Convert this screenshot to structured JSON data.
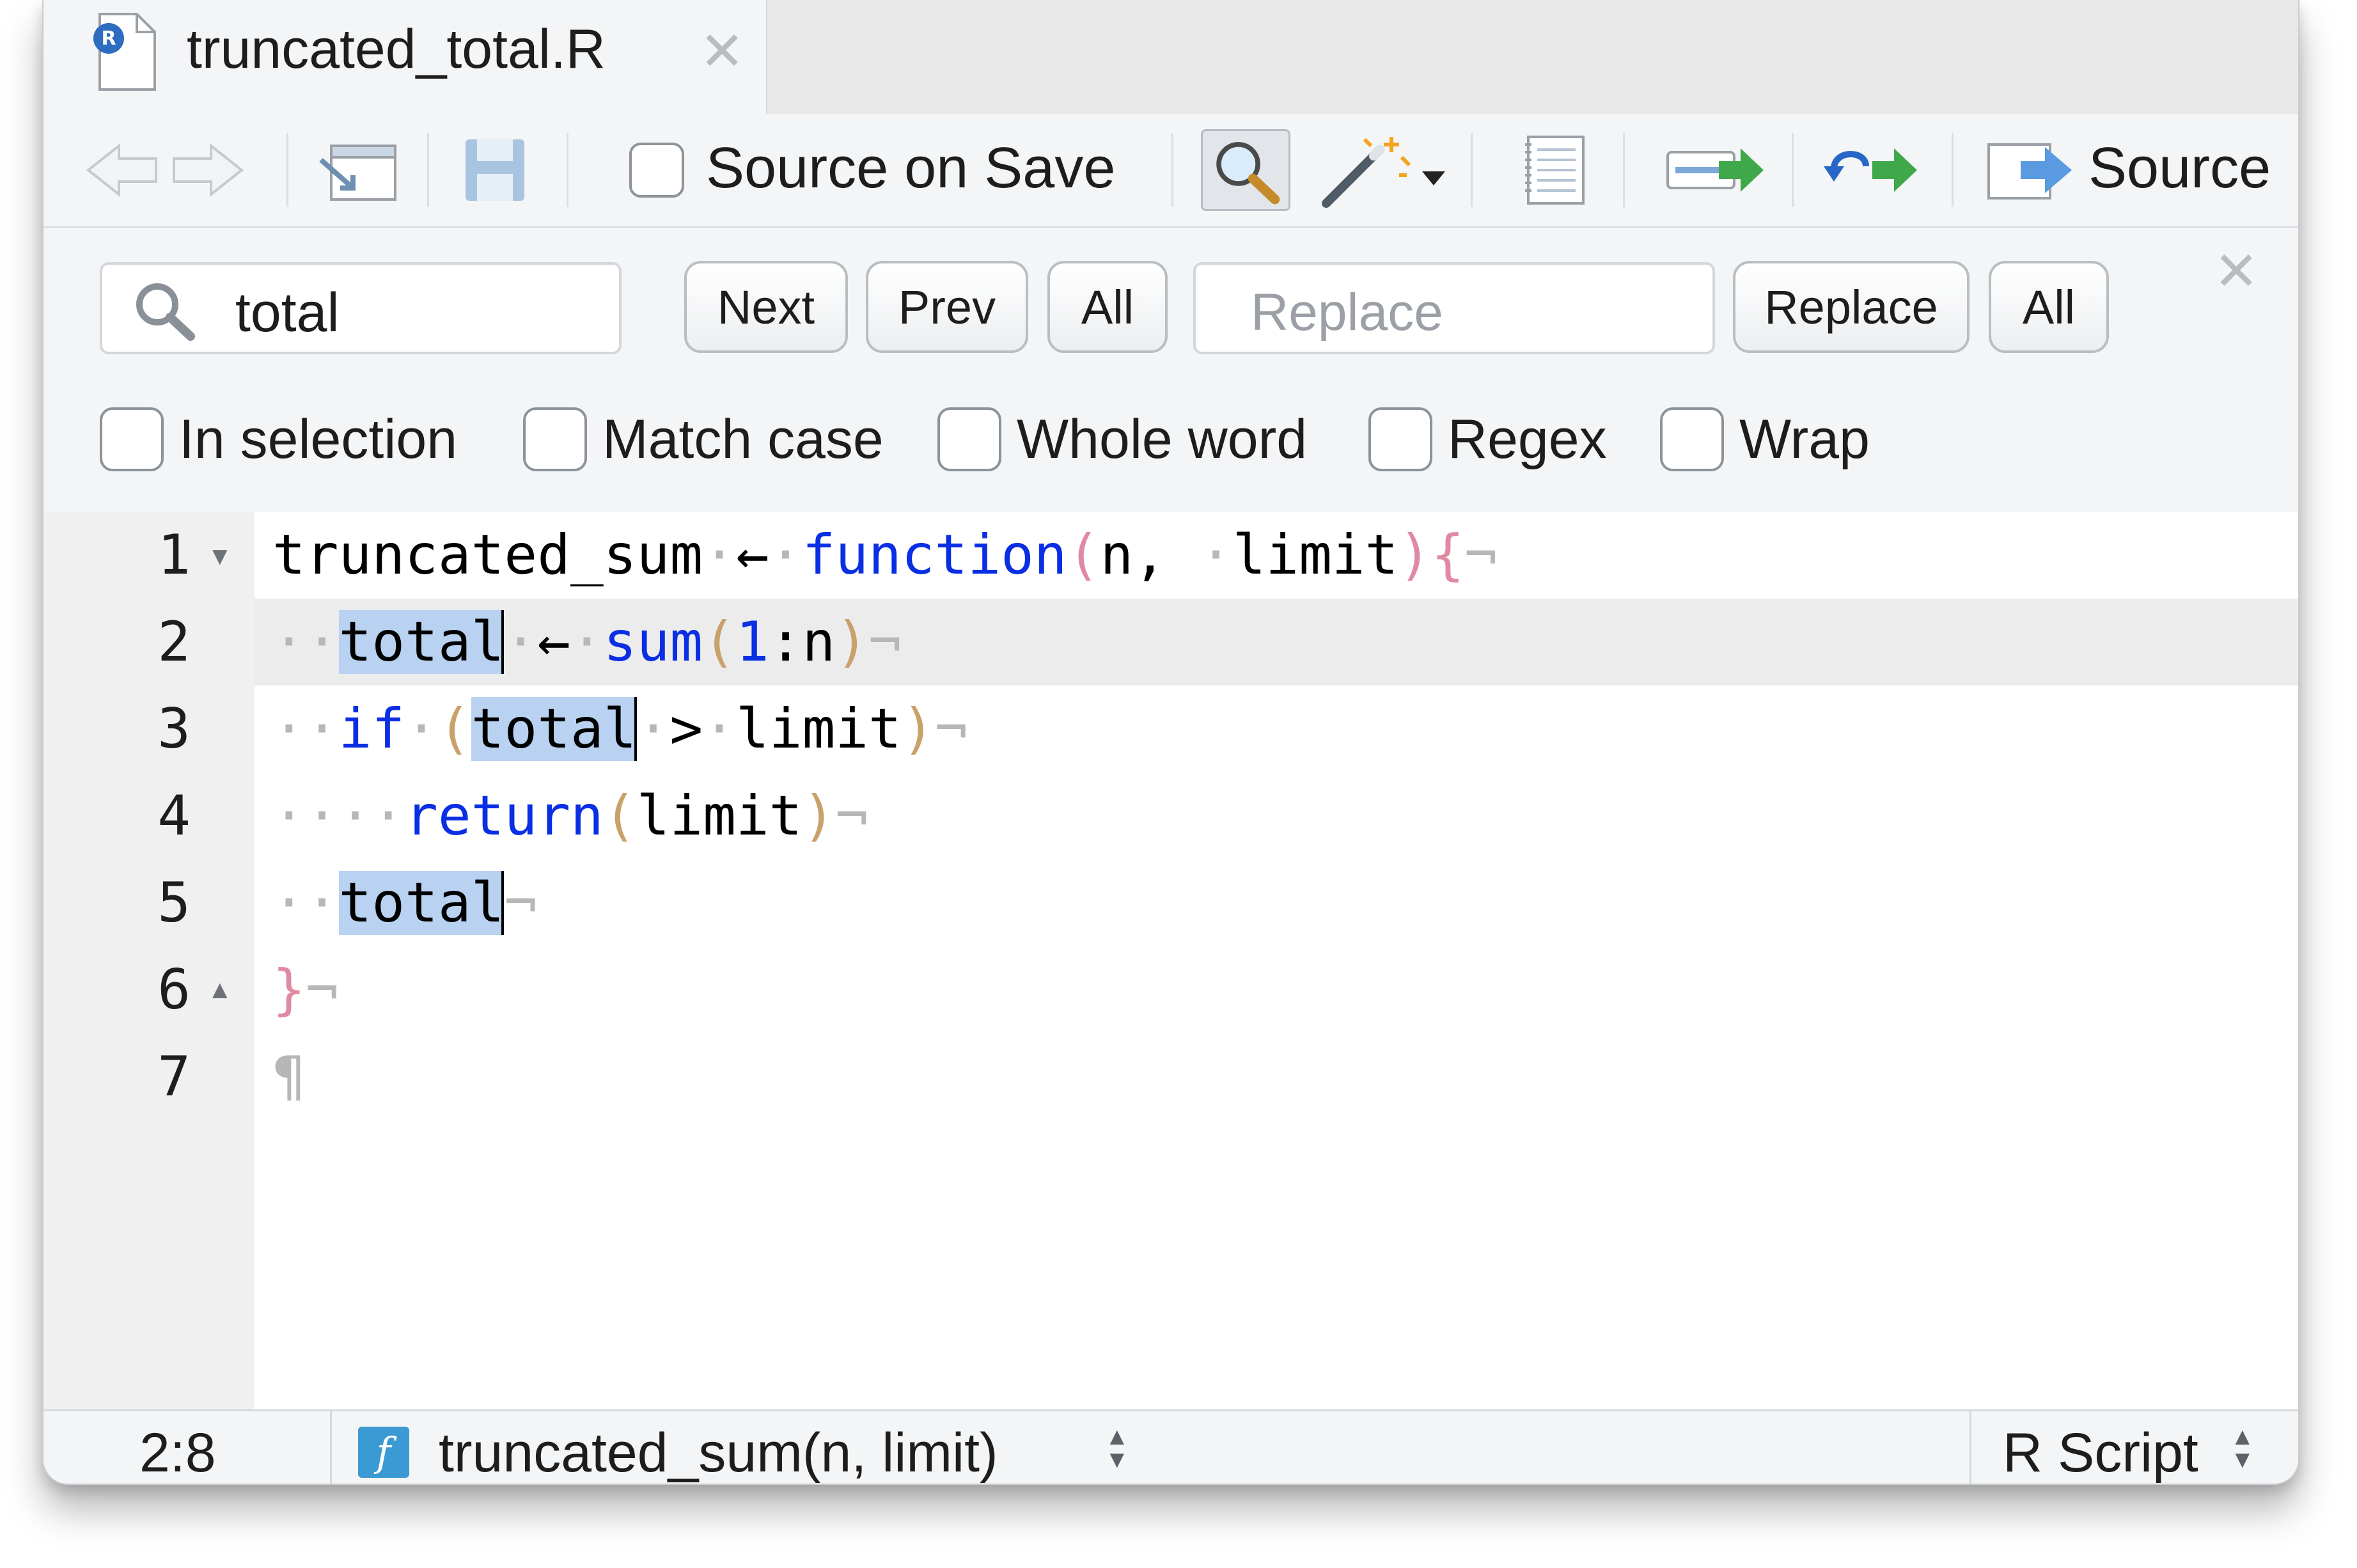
{
  "tab": {
    "filename": "truncated_total.R",
    "file_icon_letter": "R",
    "close_icon": "close-icon"
  },
  "toolbar": {
    "source_on_save_label": "Source on Save",
    "source_label": "Source"
  },
  "find": {
    "search_value": "total",
    "next_label": "Next",
    "prev_label": "Prev",
    "all_label": "All",
    "replace_placeholder": "Replace",
    "replace_label": "Replace",
    "replace_all_label": "All",
    "options": {
      "in_selection": "In selection",
      "match_case": "Match case",
      "whole_word": "Whole word",
      "regex": "Regex",
      "wrap": "Wrap"
    }
  },
  "editor": {
    "line_numbers": [
      "1",
      "2",
      "3",
      "4",
      "5",
      "6",
      "7"
    ],
    "lines": {
      "l1": {
        "name": "truncated_sum",
        "arrow": "←",
        "fn": "function",
        "lp": "(",
        "args": "n, ",
        "arg2": "limit",
        "rp": ")",
        "brace": "{"
      },
      "l2": {
        "var": "total",
        "arrow": "←",
        "call": "sum",
        "lp": "(",
        "num": "1",
        "colon": ":n",
        "rp": ")"
      },
      "l3": {
        "kw": "if",
        "lp": "(",
        "var": "total",
        "op": ">",
        "rhs": "limit",
        "rp": ")"
      },
      "l4": {
        "kw": "return",
        "lp": "(",
        "arg": "limit",
        "rp": ")"
      },
      "l5": {
        "var": "total"
      },
      "l6": {
        "brace": "}"
      },
      "l7": {
        "pilcrow": "¶"
      }
    },
    "eol_mark": "¬",
    "space_dot": "·"
  },
  "status": {
    "position": "2:8",
    "function_icon_letter": "f",
    "function": "truncated_sum(n, limit)",
    "file_type": "R Script"
  },
  "colors": {
    "keyword": "#0a2ee3",
    "paren": "#c9a16a",
    "brace": "#e08aa2",
    "highlight": "#b9d2f2",
    "function_icon": "#3b9ad3"
  }
}
